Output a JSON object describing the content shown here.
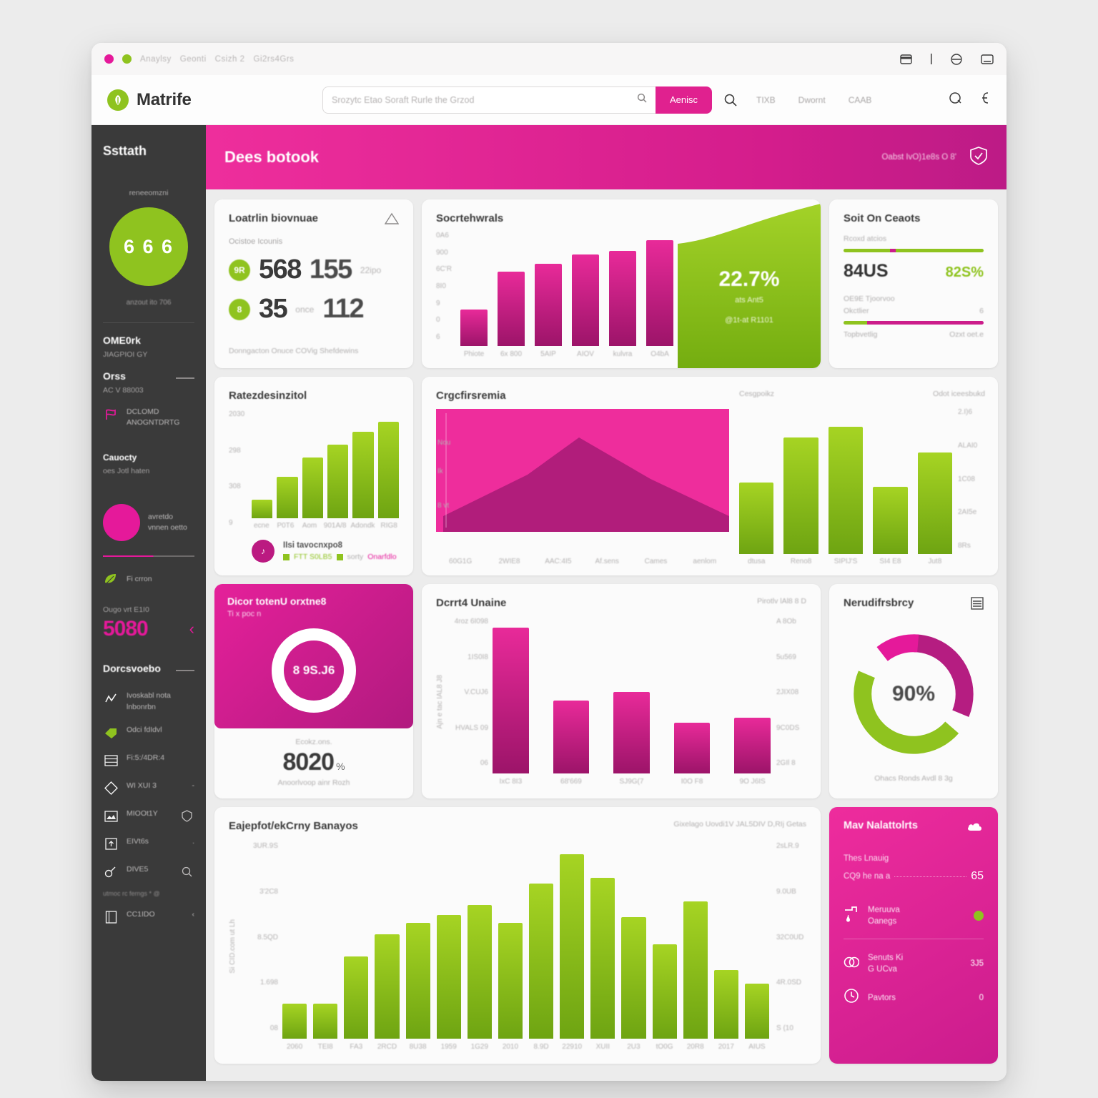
{
  "chrome": {
    "tabs": [
      "Anaylsy",
      "Geonti",
      "Csizh 2",
      "Gi2rs4Grs"
    ],
    "icons": [
      "wallet-icon",
      "divider-icon",
      "user-circle-icon",
      "window-icon"
    ]
  },
  "toolbar": {
    "brand": "Matrife",
    "logo_icon": "leaf-logo-icon",
    "search_placeholder": "Srozytc Etao Soraft Rurle the  Grzod",
    "search_icon": "search-icon",
    "search_button": "Aenisc",
    "magnifier_icon": "search-icon",
    "links": [
      "TIXB",
      "Dwornt",
      "CAAB"
    ],
    "right_icons": [
      "chat-icon",
      "currency-icon"
    ]
  },
  "sidebar": {
    "title": "Ssttath",
    "subtitle": "reneeomzni",
    "circle_value": "6 6 6",
    "circle_caption": "anzout ito 706",
    "sections": [
      {
        "heading": "OME0rk",
        "text": "JIAGPIOI GY"
      },
      {
        "heading": "Orss",
        "text": "AC V 88003"
      }
    ],
    "item_alert": {
      "icon": "flag-icon",
      "label": "DCLOMD\nANOGNTDRTG"
    },
    "group2": {
      "heading": "Cauocty",
      "text": "oes Jotl haten"
    },
    "big_item": {
      "label": "avretdo\nvnnen oetto"
    },
    "green_item": {
      "icon": "leaf-icon",
      "label": "Fi crron"
    },
    "counter": {
      "caption": "Ougo vrt E1I0",
      "value": "5080",
      "chevron": "chevron-left-icon"
    },
    "footer_heading": "Dorcsvoebo",
    "nav": [
      {
        "icon": "analytics-icon",
        "label": "Ivoskabl nota\nlnbonrbn",
        "right": ""
      },
      {
        "icon": "tag-icon",
        "label": "Odci fdIdvl",
        "right": ""
      },
      {
        "icon": "table-icon",
        "label": "Fi:5:/4DR:4",
        "right": ""
      },
      {
        "icon": "diamond-icon",
        "label": "WI XUI 3",
        "right": "-"
      },
      {
        "icon": "image-icon",
        "label": "MIOOt1Y",
        "right": "shield-icon"
      },
      {
        "icon": "upload-icon",
        "label": "EIVt6s",
        "right": "."
      },
      {
        "icon": "link-icon",
        "label": "DIVE5",
        "right": "search-icon"
      }
    ],
    "nav_note": "utmoc rc ferngs * @",
    "nav_last": {
      "icon": "book-icon",
      "label": "CC1IDO",
      "right": "chevron-left-icon"
    }
  },
  "page_header": {
    "title": "Dees botook",
    "meta": "Oabst IvO)1e8s O 8'",
    "icon": "shield-check-icon"
  },
  "cards": {
    "kpi": {
      "title": "Loatrlin biovnuae",
      "warning_icon": "warning-triangle-icon",
      "subtitle": "Ocistoe Icounis",
      "rows": [
        {
          "badge": "9R",
          "value": "568",
          "value2": "155",
          "unit": "22ipo"
        },
        {
          "badge": "8",
          "value": "35",
          "value2": "112",
          "unit": "once"
        }
      ],
      "footnote": "Donngacton Onuce COVig Shefdewins"
    },
    "stats": {
      "title": "Soit On Ceaots",
      "label1": "Rcoxd atcios",
      "bar1": {
        "green_pct": 33,
        "pink_pct": 4,
        "rest_pct": 63
      },
      "value": "84US",
      "delta": "82S%",
      "label2": "OE9E Tjoorvoo",
      "label3": "Okctlier",
      "label3_right": "6",
      "bar2": {
        "green_pct": 17,
        "pink_pct": 83
      },
      "foot_left": "Topbvetlig",
      "foot_right": "Ozxt oet.e"
    },
    "donut_card": {
      "title": "Dicor totenU orxtne8",
      "subtitle": "Ti x poc n",
      "ring_value": "8 9S.J6",
      "caption": "Ecokz.ons.",
      "big_value": "8020",
      "big_suffix": "%",
      "foot": "Anoorlvoop ainr Rozh"
    },
    "gauge": {
      "title": "Nerudifrsbrcy",
      "menu_icon": "list-icon",
      "center": "90%",
      "caption": "Ohacs Ronds Avdl 8 3g"
    },
    "metrics": {
      "title": "Mav Nalattolrts",
      "icon": "cloud-icon",
      "subtitle": "Thes Lnauig",
      "row0": {
        "label": "CQ9 he na a",
        "value": "65"
      },
      "rows": [
        {
          "icon": "faucet-icon",
          "label": "Meruuva\nOanegs",
          "value": "●"
        },
        {
          "icon": "gauge-icon",
          "label": "Senuts Ki\nG UCva",
          "value": "3J5"
        },
        {
          "icon": "clock-icon",
          "label": "Pavtors",
          "value": "0"
        }
      ]
    }
  },
  "chart_data": [
    {
      "id": "bars_pink_top",
      "type": "bar",
      "title": "Socrtehwrals",
      "categories": [
        "Phiote",
        "6x 800",
        "5AIP",
        "AIOV",
        "kulvra",
        "O4bA"
      ],
      "values": [
        300,
        620,
        680,
        760,
        790,
        880
      ],
      "ylim": [
        0,
        950
      ],
      "ytick_labels": [
        "0A6",
        "900",
        "6C'R",
        "8I0",
        "9",
        "0",
        "6"
      ],
      "color": "#d9228f",
      "ylabel": "",
      "xlabel": "",
      "grid": true
    },
    {
      "id": "growth_area_top",
      "type": "area",
      "title": "",
      "values": [
        40,
        55,
        70,
        85,
        100
      ],
      "center_value": "22.7%",
      "center_label": "ats Ant5",
      "center_sub": "@1t-at  R1101",
      "color": "#8fc31f",
      "grid": false
    },
    {
      "id": "bars_green_mid_left",
      "type": "bar",
      "title": "Ratezdesinzitol",
      "categories": [
        "ecne",
        "P0T6",
        "Aom",
        "901A/8",
        "Adondk",
        "RIG8"
      ],
      "values": [
        130,
        290,
        430,
        520,
        610,
        680
      ],
      "ylim": [
        0,
        760
      ],
      "ytick_labels": [
        "2030",
        "298",
        "308",
        "9"
      ],
      "color": "#8fc31f",
      "legend": [
        "FTT S0LB5",
        "sorty",
        "Onarfdlo"
      ],
      "legend_note": "IIsi tavocnxpo8",
      "grid": true
    },
    {
      "id": "area_pink_mid",
      "type": "area",
      "title": "Crgcfirsremia",
      "categories": [
        "60G1G",
        "2WIE8",
        "AAC:4I5",
        "Af.sens",
        "Cames",
        "aenlom"
      ],
      "values": [
        0,
        35,
        100,
        62,
        30,
        5
      ],
      "ytick_labels": [
        "Nou",
        "Ik",
        "8 vt"
      ],
      "fill": "#ee2d9c",
      "series_color": "#a31a74",
      "grid": false
    },
    {
      "id": "bars_green_mid_right",
      "type": "bar",
      "title": "",
      "header_left": "Cesgpoikz",
      "header_right": "Odot iceesbukd",
      "categories": [
        "dtusa",
        "Reno8",
        "SIPIJ'S",
        "SI4 E8",
        "Jut8"
      ],
      "values": [
        380,
        620,
        680,
        360,
        540
      ],
      "ylim": [
        0,
        800
      ],
      "ytick_labels": [
        "2.I)6",
        "ALAI0",
        "1C08",
        "2AI5e",
        "8Rs"
      ],
      "color": "#8fc31f",
      "grid": true
    },
    {
      "id": "bars_pink_row3",
      "type": "bar",
      "title": "Dcrrt4 Unaine",
      "header_right": "Pirotlv lAl8 8 D",
      "categories": [
        "IxC 8I3",
        "68'669",
        "SJ9G(7",
        "I0O F8",
        "9O J6IS"
      ],
      "values": [
        860,
        430,
        480,
        300,
        330
      ],
      "ylim": [
        0,
        920
      ],
      "ytick_left": [
        "4roz 6I098",
        "1IS0I8",
        "V.CUJ6",
        "HVALS 09",
        "06"
      ],
      "ytick_right": [
        "A 8Ob",
        "5u569",
        "2JIX08",
        "9C0DS",
        "2GIl 8"
      ],
      "ylabel": "Ajn e tac IAL8 J8",
      "color": "#c4218c",
      "grid": true
    },
    {
      "id": "bars_green_bottom",
      "type": "bar",
      "title": "Eajepfot/ekCrny Banayos",
      "header_right": "Gixelago Uovdi1V  JAL5DIV D,RIj Getas",
      "categories": [
        "2060",
        "TEI8",
        "FA3",
        "2RCD",
        "8U38",
        "1959",
        "1G29",
        "2010",
        "8.9D",
        "22910",
        "XUII",
        "2U3",
        "tO0G",
        "20R8",
        "2017",
        "AIUS"
      ],
      "values": [
        180,
        180,
        420,
        530,
        590,
        630,
        680,
        590,
        790,
        940,
        820,
        620,
        480,
        700,
        350,
        280
      ],
      "ylim": [
        0,
        1000
      ],
      "ytick_left": [
        "3UR.9S",
        "3'2C8",
        "8.5QD",
        "1.698",
        "08"
      ],
      "ytick_right": [
        "2sLR.9",
        "9.0UB",
        "32C0UD",
        "4R.0SD",
        "S (10"
      ],
      "ylabel": "Si CID.com ut  Lh",
      "color": "#8fc31f",
      "grid": true
    }
  ]
}
